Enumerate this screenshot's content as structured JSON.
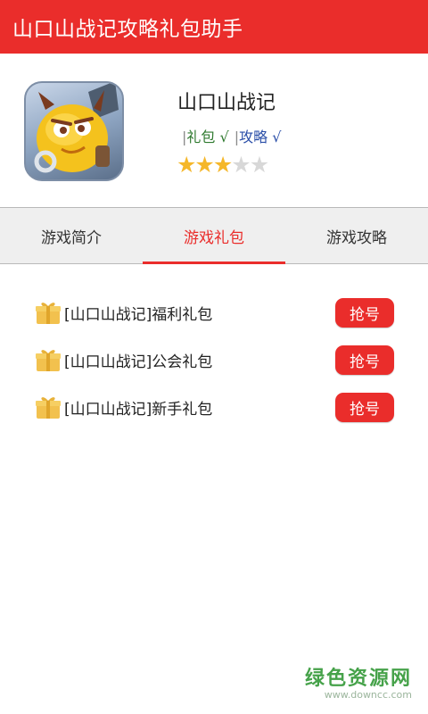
{
  "titlebar": {
    "title": "山口山战记攻略礼包助手"
  },
  "app": {
    "name": "山口山战记",
    "tag_gift": "礼包",
    "tag_guide": "攻略",
    "check_mark": "√",
    "tag_separator": "|",
    "rating": 3,
    "rating_max": 5
  },
  "tabs": [
    {
      "label": "游戏简介",
      "active": false
    },
    {
      "label": "游戏礼包",
      "active": true
    },
    {
      "label": "游戏攻略",
      "active": false
    }
  ],
  "gifts": [
    {
      "icon": "gift-icon",
      "name": "[山口山战记]福利礼包",
      "button": "抢号"
    },
    {
      "icon": "gift-icon",
      "name": "[山口山战记]公会礼包",
      "button": "抢号"
    },
    {
      "icon": "gift-icon",
      "name": "[山口山战记]新手礼包",
      "button": "抢号"
    }
  ],
  "watermark": {
    "main": "绿色资源网",
    "url": "www.downcc.com"
  },
  "colors": {
    "accent": "#ea2d2b",
    "star": "#f5b72a",
    "gift_tag": "#2f7a2f",
    "guide_tag": "#2a4ea8"
  }
}
